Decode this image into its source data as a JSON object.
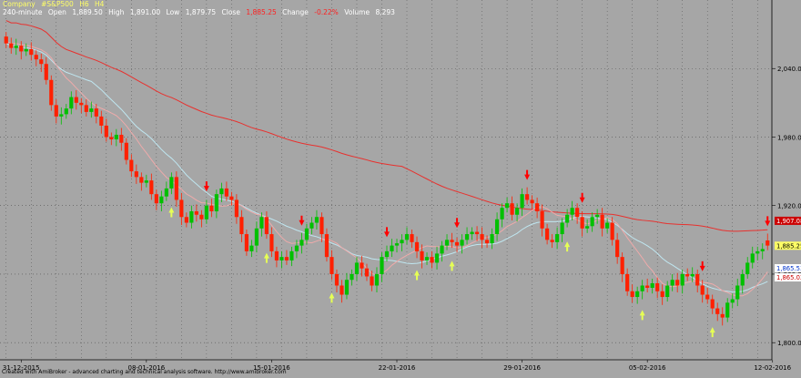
{
  "header": {
    "line1": {
      "company_label": "Company",
      "symbol": "#S&P500",
      "timeframe": "H6",
      "period_tag": "H4"
    },
    "line2": {
      "interval": "240-minute",
      "open_label": "Open",
      "open": "1,889.50",
      "high_label": "High",
      "high": "1,891.00",
      "low_label": "Low",
      "low": "1,879.75",
      "close_label": "Close",
      "close": "1,885.25",
      "change_label": "Change",
      "change": "-0.22%",
      "volume_label": "Volume",
      "volume": "8,293"
    }
  },
  "footer": {
    "text": "Created with AmiBroker - advanced charting and technical analysis software. http://www.amibroker.com"
  },
  "colors": {
    "background": "#a6a6a6",
    "bull": "#00c000",
    "bear": "#ff2000",
    "slow_ma": "#e8312e",
    "mid_ma": "#bfe6f0",
    "fast_ma": "#eeaaaa",
    "buy_arrow": "#e6ff55",
    "sell_arrow": "#ff0000",
    "header_yellow": "#ffff66",
    "header_white": "#ffffff",
    "header_red": "#ff2020"
  },
  "chart_data": {
    "type": "candlestick",
    "ylim": [
      1785,
      2100
    ],
    "y_ticks": [
      2040,
      1980,
      1920,
      1860,
      1800
    ],
    "y_tick_labels": [
      "2,040.0",
      "1,980.0",
      "1,920.0",
      "1,860.0",
      "1,800.0"
    ],
    "x_labels": [
      "31-12-2015",
      "08-01-2016",
      "15-01-2016",
      "22-01-2016",
      "29-01-2016",
      "05-02-2016",
      "12-02-2016"
    ],
    "x_label_bars": [
      3,
      28,
      53,
      78,
      103,
      128,
      153
    ],
    "price_labels": [
      {
        "value": 1907.08,
        "text": "1,907.08",
        "series": "slow"
      },
      {
        "value": 1885.25,
        "text": "1,885.25",
        "series": "price"
      },
      {
        "value": 1865.53,
        "text": "1,865.53",
        "series": "mid"
      },
      {
        "value": 1865.02,
        "text": "1,865.02",
        "series": "fast"
      }
    ],
    "closes": [
      2062,
      2058,
      2060,
      2055,
      2057,
      2052,
      2048,
      2044,
      2030,
      2008,
      1998,
      2000,
      2005,
      2015,
      2010,
      2008,
      2002,
      2005,
      1998,
      1990,
      1980,
      1978,
      1982,
      1975,
      1960,
      1950,
      1945,
      1940,
      1942,
      1930,
      1922,
      1928,
      1935,
      1945,
      1925,
      1910,
      1905,
      1915,
      1912,
      1908,
      1920,
      1915,
      1930,
      1935,
      1928,
      1925,
      1910,
      1895,
      1880,
      1885,
      1900,
      1910,
      1895,
      1880,
      1872,
      1875,
      1872,
      1880,
      1885,
      1890,
      1900,
      1905,
      1910,
      1895,
      1875,
      1860,
      1850,
      1842,
      1855,
      1860,
      1870,
      1865,
      1858,
      1850,
      1860,
      1875,
      1880,
      1885,
      1887,
      1890,
      1895,
      1888,
      1880,
      1872,
      1875,
      1870,
      1878,
      1885,
      1890,
      1888,
      1885,
      1890,
      1895,
      1897,
      1895,
      1890,
      1887,
      1895,
      1908,
      1918,
      1922,
      1912,
      1918,
      1930,
      1925,
      1922,
      1915,
      1900,
      1890,
      1888,
      1895,
      1905,
      1912,
      1918,
      1910,
      1900,
      1902,
      1910,
      1912,
      1900,
      1905,
      1890,
      1875,
      1860,
      1845,
      1840,
      1845,
      1850,
      1848,
      1852,
      1845,
      1840,
      1850,
      1855,
      1850,
      1860,
      1858,
      1860,
      1850,
      1842,
      1838,
      1830,
      1825,
      1822,
      1835,
      1838,
      1850,
      1860,
      1870,
      1878,
      1880,
      1882,
      1885
    ],
    "opens": [
      2068,
      2062,
      2058,
      2060,
      2055,
      2057,
      2052,
      2048,
      2044,
      2030,
      2008,
      1998,
      2000,
      2005,
      2015,
      2010,
      2008,
      2002,
      2005,
      1998,
      1990,
      1980,
      1978,
      1982,
      1975,
      1960,
      1950,
      1945,
      1940,
      1942,
      1930,
      1922,
      1928,
      1935,
      1945,
      1925,
      1910,
      1905,
      1915,
      1912,
      1908,
      1920,
      1915,
      1930,
      1935,
      1928,
      1925,
      1910,
      1895,
      1880,
      1885,
      1900,
      1910,
      1895,
      1880,
      1872,
      1875,
      1872,
      1880,
      1885,
      1890,
      1900,
      1905,
      1910,
      1895,
      1875,
      1860,
      1850,
      1842,
      1855,
      1860,
      1870,
      1865,
      1858,
      1850,
      1860,
      1875,
      1880,
      1885,
      1887,
      1890,
      1895,
      1888,
      1880,
      1872,
      1875,
      1870,
      1878,
      1885,
      1890,
      1888,
      1885,
      1890,
      1895,
      1897,
      1895,
      1890,
      1887,
      1895,
      1908,
      1918,
      1922,
      1912,
      1918,
      1930,
      1925,
      1922,
      1915,
      1900,
      1890,
      1888,
      1895,
      1905,
      1912,
      1918,
      1910,
      1900,
      1902,
      1910,
      1912,
      1900,
      1905,
      1890,
      1875,
      1860,
      1845,
      1840,
      1845,
      1850,
      1848,
      1852,
      1845,
      1840,
      1850,
      1855,
      1850,
      1860,
      1858,
      1860,
      1850,
      1842,
      1838,
      1830,
      1825,
      1822,
      1835,
      1838,
      1850,
      1860,
      1870,
      1878,
      1880,
      1889.5
    ],
    "sell_arrow_bars": [
      40,
      59,
      76,
      90,
      104,
      115,
      139,
      152
    ],
    "buy_arrow_bars": [
      33,
      52,
      65,
      82,
      89,
      112,
      127,
      141
    ],
    "series": [
      {
        "key": "slow",
        "from": 2052,
        "to": 1907.08
      },
      {
        "key": "mid",
        "from": 2060,
        "to": 1865.53
      },
      {
        "key": "fast",
        "from": 2058,
        "to": 1865.02
      }
    ],
    "grid": true
  }
}
